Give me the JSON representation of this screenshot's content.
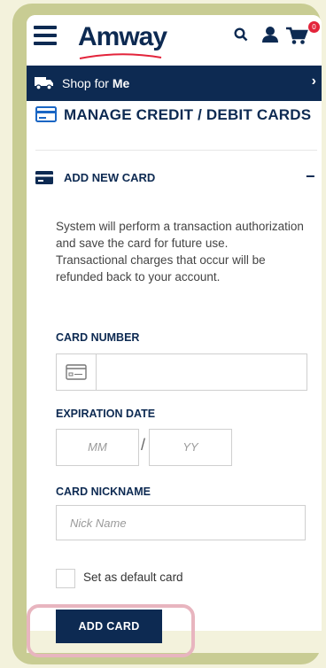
{
  "header": {
    "logo_text": "Amway",
    "cart_count": "0",
    "icons": [
      "menu-icon",
      "search-icon",
      "user-icon",
      "cart-icon"
    ]
  },
  "shop_bar": {
    "prefix": "Shop for",
    "target": "Me",
    "icon": "truck-icon"
  },
  "page": {
    "title": "MANAGE CREDIT / DEBIT CARDS"
  },
  "add_card_section": {
    "heading": "ADD NEW CARD",
    "collapse_symbol": "−",
    "info_line1": "System will perform a transaction authorization and save the card for future use.",
    "info_line2": "Transactional charges that occur will be refunded back to your account.",
    "card_number_label": "CARD NUMBER",
    "card_number_value": "",
    "expiration_label": "EXPIRATION DATE",
    "expiration_month_placeholder": "MM",
    "expiration_separator": "/",
    "expiration_year_placeholder": "YY",
    "nickname_label": "CARD NICKNAME",
    "nickname_placeholder": "Nick Name",
    "default_checkbox_label": "Set as default card",
    "default_checked": false,
    "submit_label": "ADD CARD"
  },
  "colors": {
    "brand_navy": "#0d2a52",
    "badge_red": "#e3243b",
    "highlight_pink": "#e8b5bf",
    "frame_olive": "#c8cc93"
  }
}
